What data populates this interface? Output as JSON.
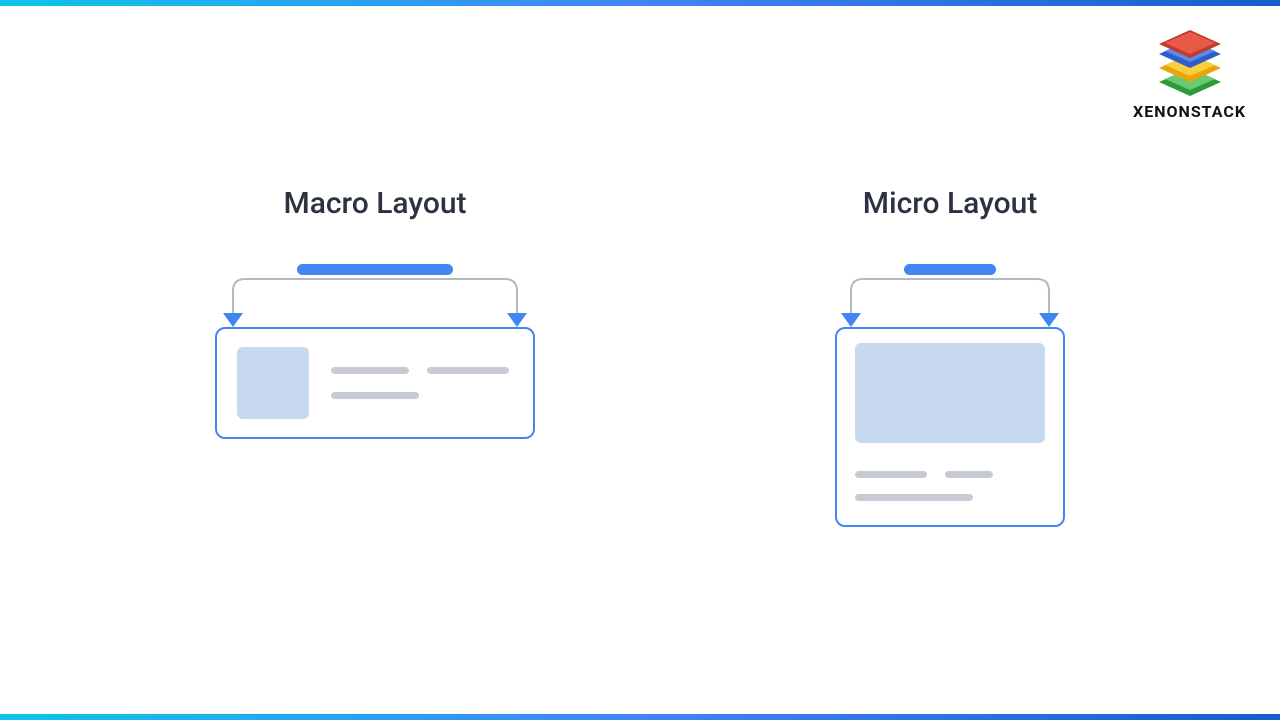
{
  "brand": {
    "name": "XENONSTACK"
  },
  "layout": {
    "left": {
      "title": "Macro Layout"
    },
    "right": {
      "title": "Micro Layout"
    }
  },
  "colors": {
    "accent": "#4285f4",
    "placeholder_block": "#c7d9ee",
    "placeholder_line": "#c7ccd4",
    "heading": "#2b3340"
  }
}
